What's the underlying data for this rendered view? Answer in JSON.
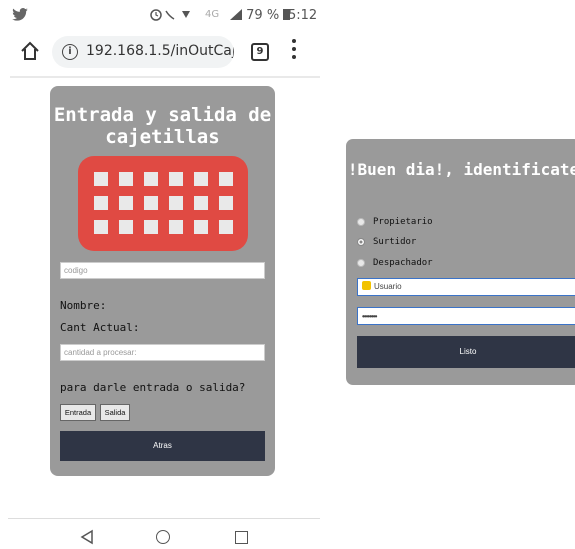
{
  "status_bar": {
    "battery": "79 %",
    "time": "5:12",
    "network": "4G"
  },
  "browser": {
    "url": "192.168.1.5/inOutCajet",
    "tab_count": "9"
  },
  "left_panel": {
    "title": "Entrada y salida de cajetillas",
    "codigo_placeholder": "codigo",
    "nombre_label": "Nombre:",
    "cant_actual_label": "Cant Actual:",
    "cantidad_placeholder": "cantidad a procesar:",
    "question": "para darle entrada o salida?",
    "entrada_button": "Entrada",
    "salida_button": "Salida",
    "atras_button": "Atras"
  },
  "right_panel": {
    "title": "!Buen dia!, identificate",
    "roles": [
      {
        "label": "Propietario",
        "selected": false
      },
      {
        "label": "Surtidor",
        "selected": true
      },
      {
        "label": "Despachador",
        "selected": false
      }
    ],
    "usuario_placeholder": "Usuario",
    "password_value": "••••••••",
    "listo_button": "Listo"
  },
  "colors": {
    "card_background": "#9a9a9a",
    "button_dark": "#2f3545",
    "keypad_red": "#e04a43"
  }
}
